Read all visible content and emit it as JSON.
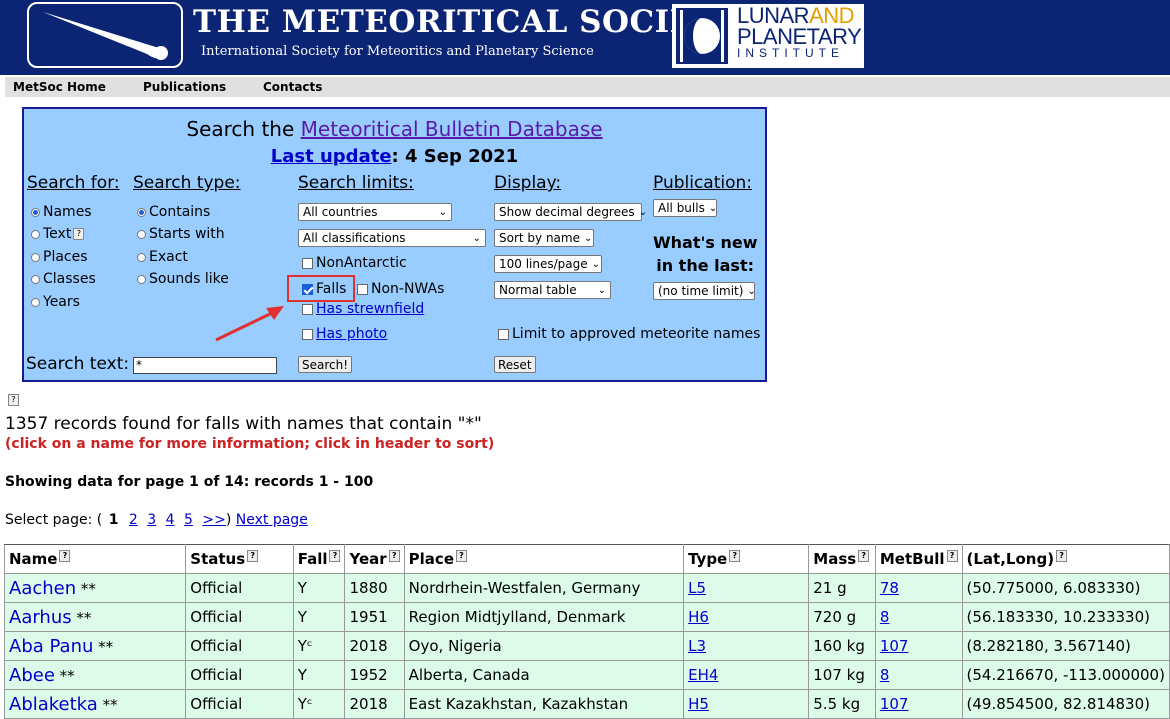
{
  "header": {
    "title": "THE METEORITICAL SOCIETY",
    "subtitle": "International Society for Meteoritics and Planetary Science",
    "partner_logo": {
      "line1": "LUNAR",
      "line1b": "AND",
      "line2": "PLANETARY",
      "line3": "INSTITUTE"
    }
  },
  "nav": {
    "items": [
      "MetSoc Home",
      "Publications",
      "Contacts"
    ]
  },
  "panel": {
    "title_prefix": "Search the ",
    "title_link": "Meteoritical Bulletin Database",
    "update_link": "Last update",
    "update_date": ": 4 Sep 2021",
    "search_for": {
      "label": "Search for:",
      "options": [
        "Names",
        "Text",
        "Places",
        "Classes",
        "Years"
      ],
      "selected": "Names"
    },
    "search_type": {
      "label": "Search type:",
      "options": [
        "Contains",
        "Starts with",
        "Exact",
        "Sounds like"
      ],
      "selected": "Contains"
    },
    "search_limits": {
      "label": "Search limits:",
      "countries": "All countries",
      "classifications": "All classifications",
      "non_antarctic": "NonAntarctic",
      "falls": "Falls",
      "non_nwas": "Non-NWAs",
      "has_strewnfield": "Has strewnfield",
      "has_photo": "Has photo"
    },
    "display": {
      "label": "Display:",
      "degrees": "Show decimal degrees",
      "sort": "Sort by name",
      "lines": "100 lines/page",
      "table": "Normal table",
      "approved": "Limit to approved meteorite names"
    },
    "publication": {
      "label": "Publication:",
      "bulls": "All bulls",
      "whats_new_1": "What's new",
      "whats_new_2": "in the last:",
      "time_limit": "(no time limit)"
    },
    "search_text_label": "Search text:",
    "search_text_value": "*",
    "search_button": "Search!",
    "reset_button": "Reset"
  },
  "results": {
    "records_found": "1357 records found for falls with names that contain \"*\"",
    "hint": "(click on a name for more information; click in header to sort)",
    "showing": "Showing data for page 1 of 14: records 1 - 100",
    "select_page_label": "Select page: (",
    "current_page": "1",
    "pages": [
      "2",
      "3",
      "4",
      "5",
      ">>"
    ],
    "close_paren": ")",
    "next_page": "Next page",
    "columns": [
      "Name",
      "Status",
      "Fall",
      "Year",
      "Place",
      "Type",
      "Mass",
      "MetBull",
      "(Lat,Long)"
    ],
    "rows": [
      {
        "name": "Aachen",
        "stars": " **",
        "status": "Official",
        "fall": "Y",
        "year": "1880",
        "place": "Nordrhein-Westfalen, Germany",
        "type": "L5",
        "mass": "21 g",
        "metbull": "78",
        "latlong": "(50.775000, 6.083330)"
      },
      {
        "name": "Aarhus",
        "stars": " **",
        "status": "Official",
        "fall": "Y",
        "year": "1951",
        "place": "Region Midtjylland, Denmark",
        "type": "H6",
        "mass": "720 g",
        "metbull": "8",
        "latlong": "(56.183330, 10.233330)"
      },
      {
        "name": "Aba Panu",
        "stars": " **",
        "status": "Official",
        "fall": "Yᶜ",
        "year": "2018",
        "place": "Oyo, Nigeria",
        "type": "L3",
        "mass": "160 kg",
        "metbull": "107",
        "latlong": "(8.282180, 3.567140)"
      },
      {
        "name": "Abee",
        "stars": " **",
        "status": "Official",
        "fall": "Y",
        "year": "1952",
        "place": "Alberta, Canada",
        "type": "EH4",
        "mass": "107 kg",
        "metbull": "8",
        "latlong": "(54.216670, -113.000000)"
      },
      {
        "name": "Ablaketka",
        "stars": " **",
        "status": "Official",
        "fall": "Yᶜ",
        "year": "2018",
        "place": "East Kazakhstan, Kazakhstan",
        "type": "H5",
        "mass": "5.5 kg",
        "metbull": "107",
        "latlong": "(49.854500, 82.814830)"
      }
    ]
  }
}
